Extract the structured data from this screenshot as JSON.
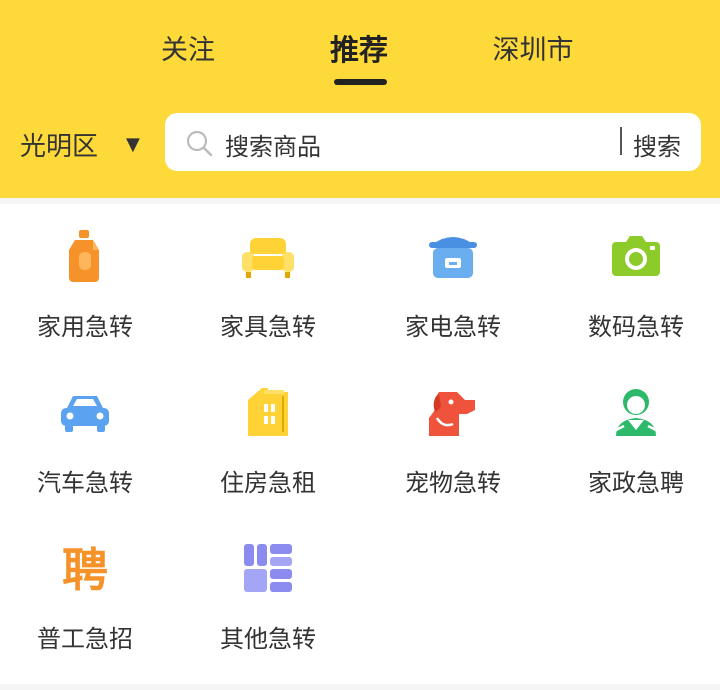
{
  "tabs": [
    {
      "label": "关注",
      "active": false
    },
    {
      "label": "推荐",
      "active": true
    },
    {
      "label": "深圳市",
      "active": false
    }
  ],
  "district": {
    "label": "光明区",
    "arrow": "▼"
  },
  "search": {
    "placeholder": "搜索商品",
    "button": "搜索"
  },
  "categories": [
    {
      "label": "家用急转",
      "icon": "detergent-bottle-icon"
    },
    {
      "label": "家具急转",
      "icon": "sofa-icon"
    },
    {
      "label": "家电急转",
      "icon": "rice-cooker-icon"
    },
    {
      "label": "数码急转",
      "icon": "camera-icon"
    },
    {
      "label": "汽车急转",
      "icon": "car-icon"
    },
    {
      "label": "住房急租",
      "icon": "building-icon"
    },
    {
      "label": "宠物急转",
      "icon": "dog-icon"
    },
    {
      "label": "家政急聘",
      "icon": "housekeeper-icon"
    },
    {
      "label": "普工急招",
      "icon": "hire-char-icon",
      "glyph": "聘"
    },
    {
      "label": "其他急转",
      "icon": "grid-blocks-icon"
    }
  ],
  "colors": {
    "header_bg": "#FED93A",
    "page_bg": "#FFFFFF"
  }
}
